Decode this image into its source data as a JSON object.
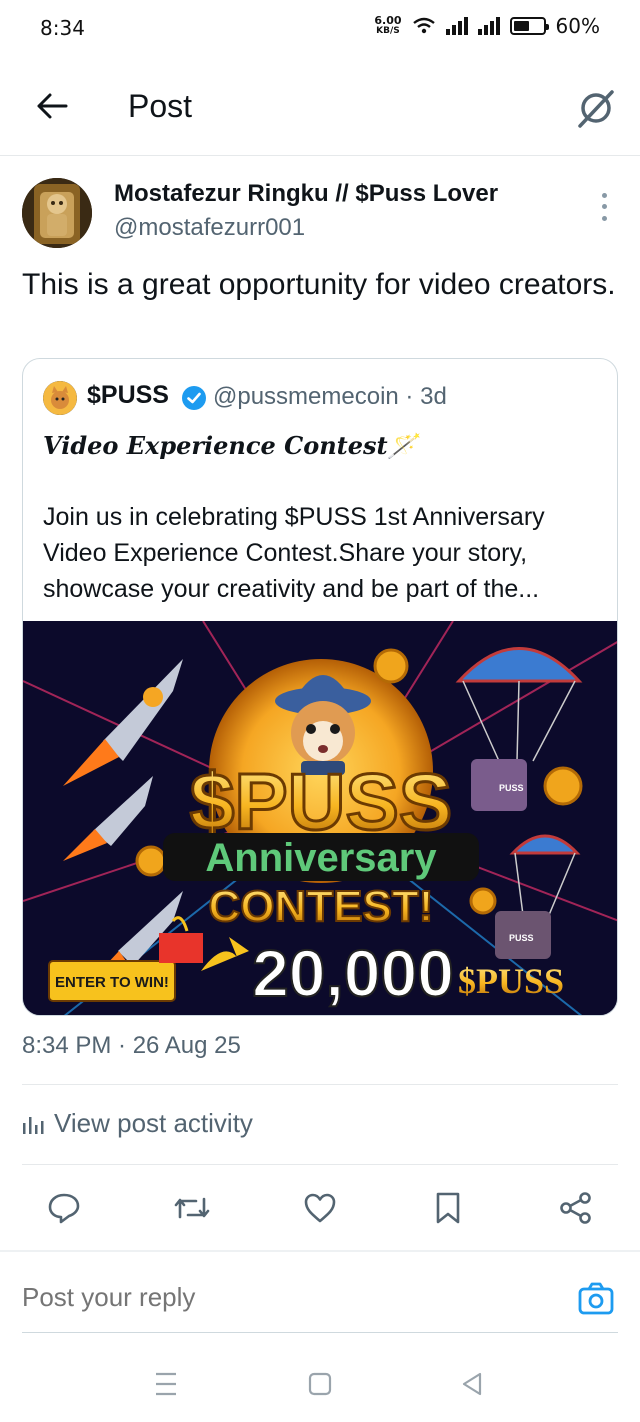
{
  "status": {
    "time": "8:34",
    "speed_value": "6.00",
    "speed_unit": "KB/S",
    "battery": "60%",
    "battery_level": 0.6
  },
  "header": {
    "title": "Post"
  },
  "post": {
    "author_name": "Mostafezur Ringku // $Puss Lover",
    "author_handle": "@mostafezurr001",
    "text": "This is a great opportunity for video creators.",
    "timestamp": "8:34 PM · 26 Aug 25"
  },
  "quote": {
    "name": "$PUSS",
    "handle_time": "@pussmemecoin · 3d",
    "title": "Video Experience Contest🪄",
    "body": "Join us in celebrating $PUSS 1st Anniversary Video Experience Contest.Share your story, showcase your creativity and be part of the...",
    "image": {
      "headline": "$PUSS",
      "subtitle": "Anniversary",
      "contest": "CONTEST!",
      "enter": "ENTER TO WIN!",
      "amount": "20,000",
      "token": "$PUSS",
      "crate_label_1": "PUSS",
      "crate_label_2": "PUSS"
    }
  },
  "activity": {
    "label": "View post activity"
  },
  "reply": {
    "placeholder": "Post your reply"
  },
  "colors": {
    "accent": "#1d9bf0",
    "muted": "#536471",
    "gold": "#f5a623"
  }
}
